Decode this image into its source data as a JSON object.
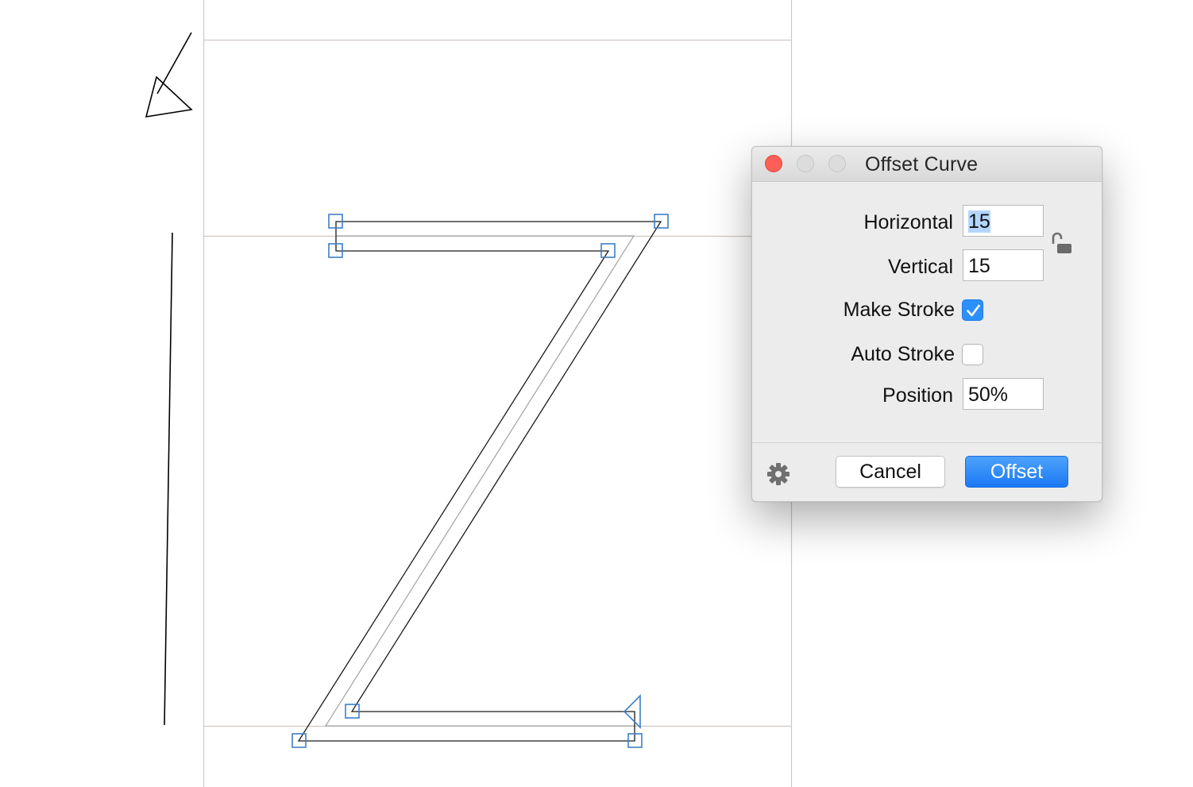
{
  "dialog": {
    "title": "Offset Curve",
    "horizontal_label": "Horizontal",
    "horizontal_value": "15",
    "vertical_label": "Vertical",
    "vertical_value": "15",
    "make_stroke_label": "Make Stroke",
    "make_stroke_checked": true,
    "auto_stroke_label": "Auto Stroke",
    "auto_stroke_checked": false,
    "position_label": "Position",
    "position_value": "50%",
    "cancel_label": "Cancel",
    "offset_label": "Offset",
    "lock_icon": "unlocked-padlock-icon",
    "options_icon": "gear-icon"
  },
  "colors": {
    "close_button": "#fc5f57",
    "primary_button": "#1b79f4",
    "checkbox_on": "#2d8ff9",
    "node_handle": "#3d7ec7",
    "selection": "#b4d6fe"
  }
}
